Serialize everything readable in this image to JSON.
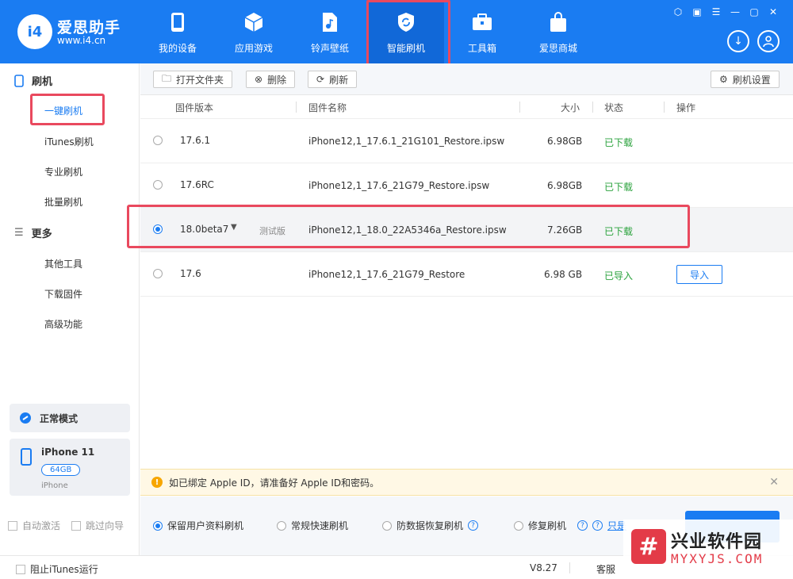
{
  "app": {
    "logo_badge": "i4",
    "logo_name": "爱思助手",
    "logo_url": "www.i4.cn"
  },
  "nav": [
    {
      "label": "我的设备",
      "icon": "phone-icon"
    },
    {
      "label": "应用游戏",
      "icon": "cube-icon"
    },
    {
      "label": "铃声壁纸",
      "icon": "music-file-icon"
    },
    {
      "label": "智能刷机",
      "icon": "refresh-shield-icon"
    },
    {
      "label": "工具箱",
      "icon": "toolbox-icon"
    },
    {
      "label": "爱思商城",
      "icon": "shopping-bag-icon"
    }
  ],
  "sidebar": {
    "group_flash": "刷机",
    "items_flash": [
      "一键刷机",
      "iTunes刷机",
      "专业刷机",
      "批量刷机"
    ],
    "group_more": "更多",
    "items_more": [
      "其他工具",
      "下载固件",
      "高级功能"
    ],
    "mode": "正常模式",
    "device_name": "iPhone 11",
    "device_capacity": "64GB",
    "device_type": "iPhone",
    "auto_activate": "自动激活",
    "skip_guide": "跳过向导"
  },
  "toolbar": {
    "open_folder": "打开文件夹",
    "delete": "删除",
    "refresh": "刷新",
    "settings": "刷机设置"
  },
  "table": {
    "headers": {
      "version": "固件版本",
      "name": "固件名称",
      "size": "大小",
      "status": "状态",
      "action": "操作"
    },
    "rows": [
      {
        "version": "17.6.1",
        "name": "iPhone12,1_17.6.1_21G101_Restore.ipsw",
        "size": "6.98GB",
        "status": "已下载"
      },
      {
        "version": "17.6RC",
        "name": "iPhone12,1_17.6_21G79_Restore.ipsw",
        "size": "6.98GB",
        "status": "已下载"
      },
      {
        "version": "18.0beta7",
        "tag": "测试版",
        "name": "iPhone12,1_18.0_22A5346a_Restore.ipsw",
        "size": "7.26GB",
        "status": "已下载"
      },
      {
        "version": "17.6",
        "name": "iPhone12,1_17.6_21G79_Restore",
        "size": "6.98 GB",
        "status": "已导入",
        "action": "导入"
      }
    ]
  },
  "notice": {
    "text": "如已绑定 Apple ID，请准备好 Apple ID和密码。"
  },
  "options": {
    "keep_data": "保留用户资料刷机",
    "quick": "常规快速刷机",
    "anti_recovery": "防数据恢复刷机",
    "repair": "修复刷机",
    "link_partial": "只是"
  },
  "statusbar": {
    "block_itunes": "阻止iTunes运行",
    "version": "V8.27",
    "service": "客服"
  },
  "watermark": {
    "mark": "#",
    "cn": "兴业软件园",
    "en": "MYXYJS.COM"
  },
  "colors": {
    "brand_blue": "#1a7cf2",
    "highlight_red": "#e9495e",
    "status_green": "#2aa23c"
  }
}
